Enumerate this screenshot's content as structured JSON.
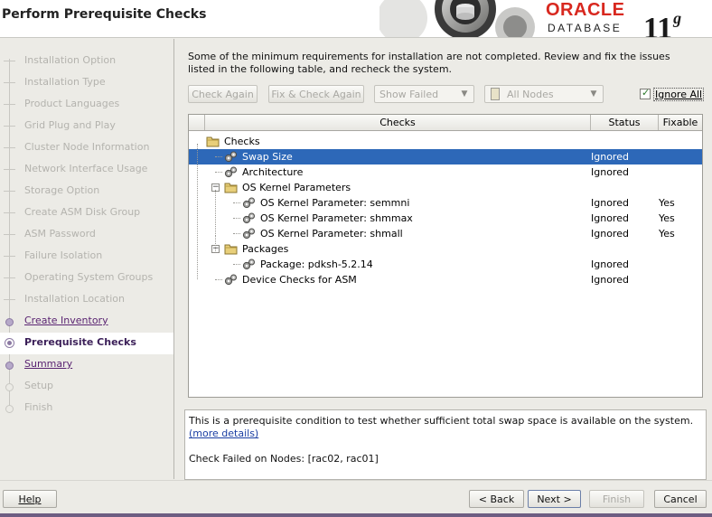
{
  "header": {
    "title": "Perform Prerequisite Checks",
    "brand_oracle": "ORACLE",
    "brand_database": "DATABASE",
    "brand_version": "11",
    "brand_version_suffix": "g",
    "brand_color": "#d8281f"
  },
  "steps": [
    {
      "label": "Installation Option",
      "state": "done"
    },
    {
      "label": "Installation Type",
      "state": "done"
    },
    {
      "label": "Product Languages",
      "state": "done"
    },
    {
      "label": "Grid Plug and Play",
      "state": "done"
    },
    {
      "label": "Cluster Node Information",
      "state": "done"
    },
    {
      "label": "Network Interface Usage",
      "state": "done"
    },
    {
      "label": "Storage Option",
      "state": "done"
    },
    {
      "label": "Create ASM Disk Group",
      "state": "done"
    },
    {
      "label": "ASM Password",
      "state": "done"
    },
    {
      "label": "Failure Isolation",
      "state": "done"
    },
    {
      "label": "Operating System Groups",
      "state": "done"
    },
    {
      "label": "Installation Location",
      "state": "done"
    },
    {
      "label": "Create Inventory",
      "state": "link"
    },
    {
      "label": "Prerequisite Checks",
      "state": "current"
    },
    {
      "label": "Summary",
      "state": "link"
    },
    {
      "label": "Setup",
      "state": "pending"
    },
    {
      "label": "Finish",
      "state": "pending"
    }
  ],
  "intro_text": "Some of the minimum requirements for installation are not completed. Review and fix the issues listed in the following table, and recheck the system.",
  "toolbar": {
    "check_again": "Check Again",
    "fix_and_check_again": "Fix & Check Again",
    "show_filter_value": "Show Failed",
    "nodes_filter_value": "All Nodes",
    "ignore_all_label": "Ignore All",
    "ignore_all_checked": true
  },
  "table": {
    "columns": [
      "Checks",
      "Status",
      "Fixable"
    ],
    "rows": [
      {
        "level": 0,
        "type": "folder",
        "name": "Checks",
        "status": "",
        "fixable": "",
        "selected": false
      },
      {
        "level": 1,
        "type": "check",
        "name": "Swap Size",
        "status": "Ignored",
        "fixable": "",
        "selected": true
      },
      {
        "level": 1,
        "type": "check",
        "name": "Architecture",
        "status": "Ignored",
        "fixable": "",
        "selected": false
      },
      {
        "level": 1,
        "type": "folder",
        "name": "OS Kernel Parameters",
        "status": "",
        "fixable": "",
        "selected": false
      },
      {
        "level": 2,
        "type": "check",
        "name": "OS Kernel Parameter: semmni",
        "status": "Ignored",
        "fixable": "Yes",
        "selected": false
      },
      {
        "level": 2,
        "type": "check",
        "name": "OS Kernel Parameter: shmmax",
        "status": "Ignored",
        "fixable": "Yes",
        "selected": false
      },
      {
        "level": 2,
        "type": "check",
        "name": "OS Kernel Parameter: shmall",
        "status": "Ignored",
        "fixable": "Yes",
        "selected": false
      },
      {
        "level": 1,
        "type": "folder",
        "name": "Packages",
        "status": "",
        "fixable": "",
        "selected": false
      },
      {
        "level": 2,
        "type": "check",
        "name": "Package: pdksh-5.2.14",
        "status": "Ignored",
        "fixable": "",
        "selected": false
      },
      {
        "level": 1,
        "type": "check",
        "name": "Device Checks for ASM",
        "status": "Ignored",
        "fixable": "",
        "selected": false
      }
    ]
  },
  "details": {
    "description": "This is a prerequisite condition to test whether sufficient total swap space is available on the system.",
    "more_details_link": "(more details)",
    "failed_nodes": "Check Failed on Nodes: [rac02, rac01]"
  },
  "footer": {
    "help": "Help",
    "back": "< Back",
    "next": "Next >",
    "finish": "Finish",
    "cancel": "Cancel"
  },
  "colors": {
    "selection": "#2d68b8",
    "accent_purple": "#5a2472"
  }
}
